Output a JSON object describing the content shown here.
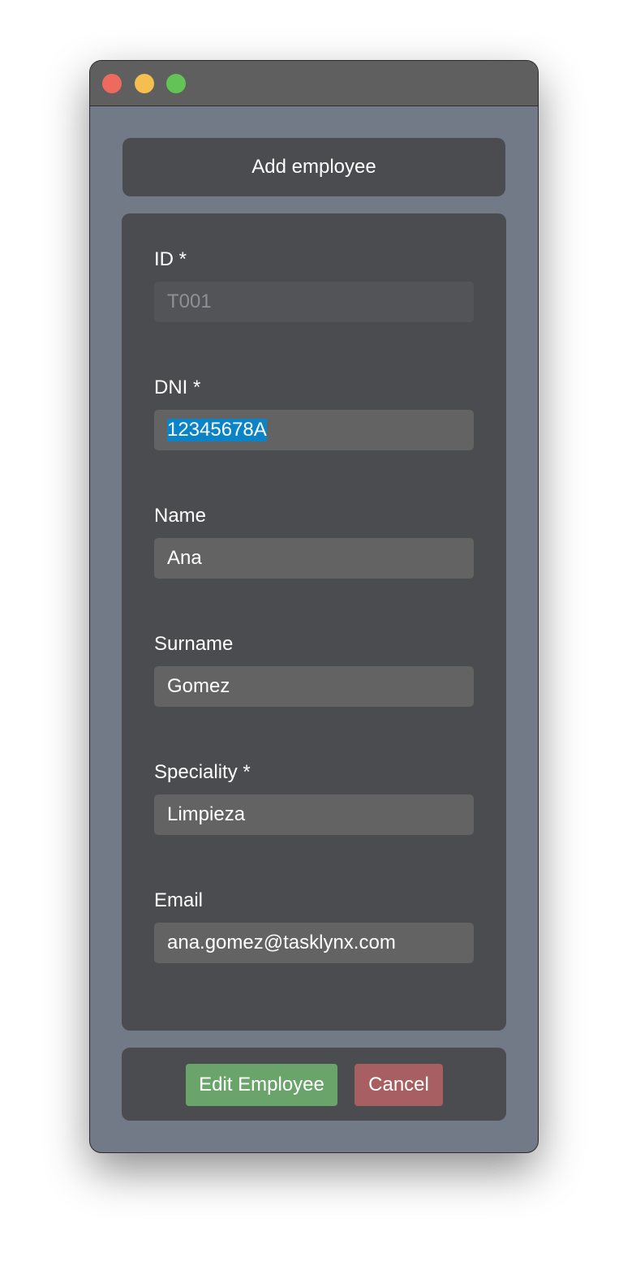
{
  "window": {
    "buttons": [
      "close",
      "minimize",
      "maximize"
    ]
  },
  "header": {
    "title": "Add employee"
  },
  "form": {
    "fields": [
      {
        "label": "ID *",
        "value": "T001",
        "disabled": true
      },
      {
        "label": "DNI *",
        "value": "12345678A",
        "selected": true
      },
      {
        "label": "Name",
        "value": "Ana"
      },
      {
        "label": "Surname",
        "value": "Gomez"
      },
      {
        "label": "Speciality *",
        "value": "Limpieza"
      },
      {
        "label": "Email",
        "value": "ana.gomez@tasklynx.com"
      }
    ]
  },
  "actions": {
    "edit_label": "Edit Employee",
    "cancel_label": "Cancel"
  },
  "colors": {
    "window_bg": "#737a87",
    "panel_bg": "#4a4c50",
    "input_bg": "#636363",
    "selection": "#0a84c6",
    "edit_button": "#6aa46a",
    "cancel_button": "#a85f62"
  }
}
